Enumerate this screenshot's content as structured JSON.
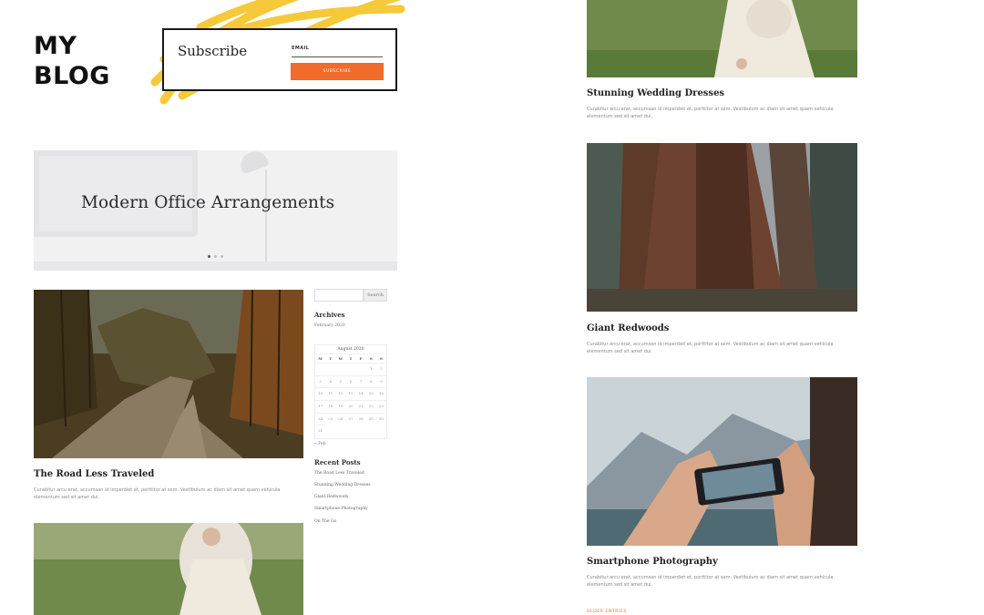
{
  "brand": {
    "line1": "MY",
    "line2": "BLOG",
    "accent": "#f26b2a",
    "scribble_color": "#f5c93a"
  },
  "subscribe": {
    "title": "Subscribe",
    "email_label": "EMAIL",
    "button_label": "SUBSCRIBE"
  },
  "hero": {
    "title": "Modern Office Arrangements"
  },
  "excerpt": "Curabitur arcu erat, accumsan id imperdiet et, porttitor at sem. Vestibulum ac diam sit amet quam vehicula elementum sed sit amet dui.",
  "posts": [
    {
      "title": "The Road Less Traveled"
    },
    {
      "title": "Stunning Wedding Dresses"
    },
    {
      "title": "Giant Redwoods"
    },
    {
      "title": "Smartphone Photography"
    }
  ],
  "sidebar": {
    "search_placeholder": "",
    "search_button": "Search",
    "archives_title": "Archives",
    "archives_item": "February 2020",
    "calendar": {
      "caption": "August 2020",
      "weekdays": [
        "M",
        "T",
        "W",
        "T",
        "F",
        "S",
        "S"
      ],
      "days": [
        "",
        "",
        "",
        "",
        "",
        "1",
        "2",
        "3",
        "4",
        "5",
        "6",
        "7",
        "8",
        "9",
        "10",
        "11",
        "12",
        "13",
        "14",
        "15",
        "16",
        "17",
        "18",
        "19",
        "20",
        "21",
        "22",
        "23",
        "24",
        "25",
        "26",
        "27",
        "28",
        "29",
        "30",
        "31"
      ],
      "prev_link": "« Feb"
    },
    "recent_title": "Recent Posts",
    "recent_posts": [
      "The Road Less Traveled",
      "Stunning Wedding Dresses",
      "Giant Redwoods",
      "Smartphone Photography",
      "On The Go"
    ]
  },
  "load_more": "OLDER ENTRIES"
}
